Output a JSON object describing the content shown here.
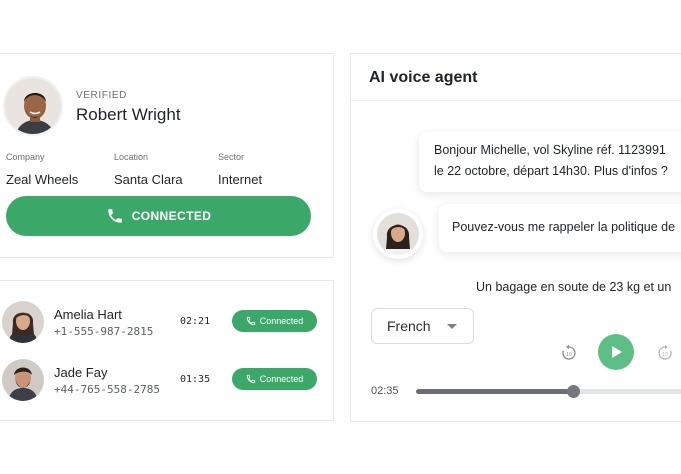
{
  "contact": {
    "status": "VERIFIED",
    "name": "Robert Wright",
    "fields": [
      {
        "label": "Company",
        "value": "Zeal Wheels"
      },
      {
        "label": "Location",
        "value": "Santa Clara"
      },
      {
        "label": "Sector",
        "value": "Internet"
      }
    ],
    "button_label": "CONNECTED",
    "button_icon": "phone-icon"
  },
  "calls": [
    {
      "name": "Amelia Hart",
      "phone": "+1-555-987-2815",
      "duration": "02:21",
      "status": "Connected"
    },
    {
      "name": "Jade Fay",
      "phone": "+44-765-558-2785",
      "duration": "01:35",
      "status": "Connected"
    }
  ],
  "agent": {
    "title": "AI voice agent",
    "messages": [
      {
        "line1": "Bonjour Michelle, vol Skyline réf. 1123991",
        "line2": "le 22 octobre, départ 14h30. Plus d'infos ?"
      },
      {
        "text": "Pouvez-vous me rappeler la politique de"
      },
      {
        "text": "Un bagage en soute de 23 kg et un"
      }
    ],
    "language": "French",
    "current_time": "02:35",
    "progress": 0.54
  },
  "colors": {
    "accent_green": "#3ba86a",
    "play_green": "#5dbf86",
    "border": "#e6e8ea"
  }
}
